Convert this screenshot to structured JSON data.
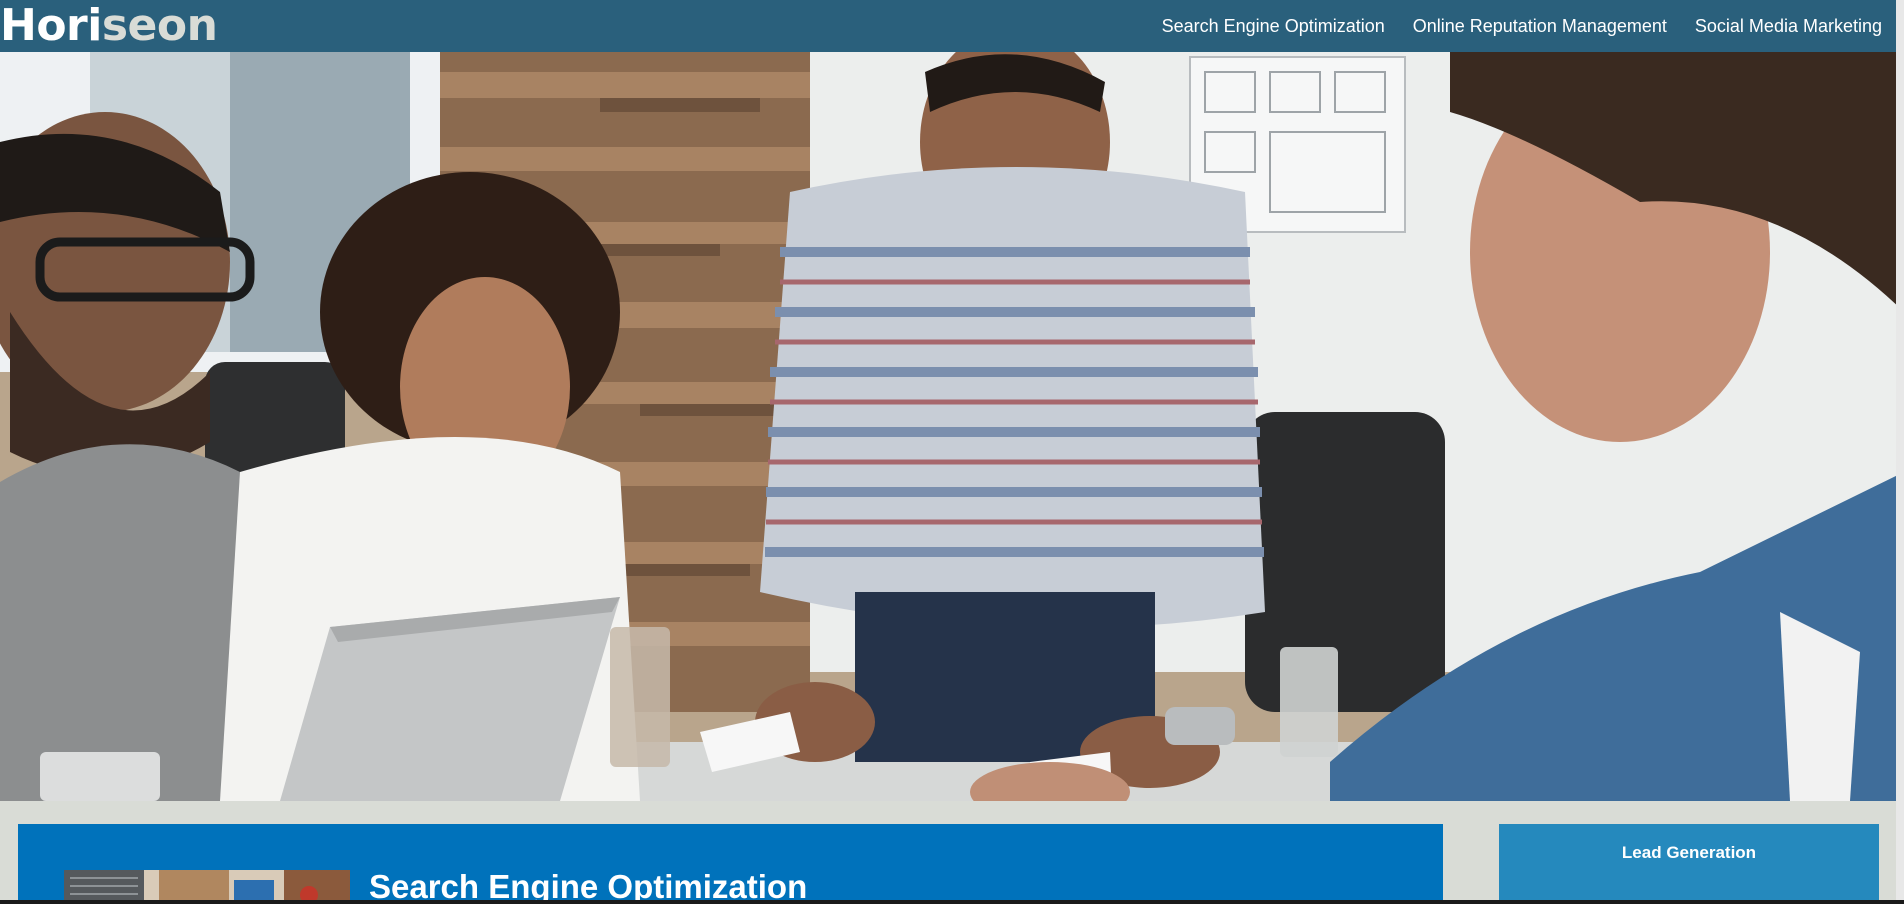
{
  "header": {
    "logo_main": "Hori",
    "logo_accent": "seon",
    "nav": [
      "Search Engine Optimization",
      "Online Reputation Management",
      "Social Media Marketing"
    ]
  },
  "hero": {
    "image_icon": "team-meeting-photo"
  },
  "content": {
    "seo_title": "Search Engine Optimization"
  },
  "benefits": {
    "lead_title": "Lead Generation"
  },
  "colors": {
    "header_bg": "#2a607c",
    "content_bg": "#0072bb",
    "benefit_bg": "#2589bd",
    "page_bg": "#d9dcd6"
  }
}
